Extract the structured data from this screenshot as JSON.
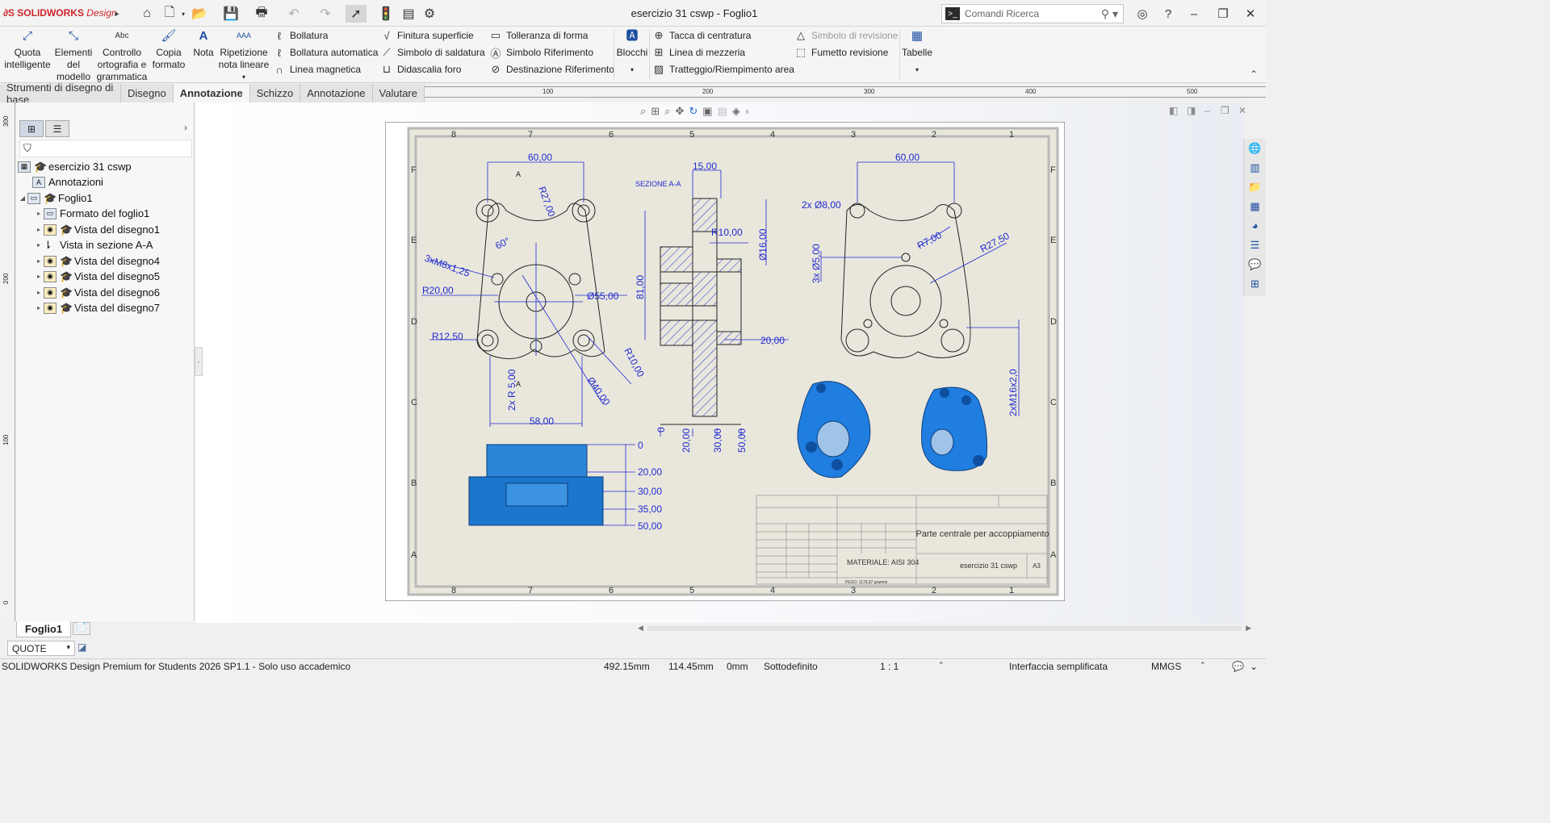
{
  "app": {
    "brand": "SOLIDWORKS",
    "brand_suffix": "Design",
    "window_title": "esercizio 31 cswp - Foglio1",
    "search_placeholder": "Comandi Ricerca"
  },
  "ribbon": {
    "quota": "Quota intelligente",
    "elementi": "Elementi del modello",
    "controllo": "Controllo ortografia e grammatica",
    "copia": "Copia formato",
    "nota": "Nota",
    "ripetizione": "Ripetizione nota lineare",
    "bollatura": "Bollatura",
    "bollatura_auto": "Bollatura automatica",
    "linea_magnetica": "Linea magnetica",
    "finitura": "Finitura superficie",
    "saldatura": "Simbolo di saldatura",
    "didascalia": "Didascalia foro",
    "tolleranza": "Tolleranza di forma",
    "riferimento": "Simbolo Riferimento",
    "destinazione": "Destinazione Riferimento",
    "blocchi": "Blocchi",
    "centratura": "Tacca di centratura",
    "mezzeria": "Linea di mezzeria",
    "tratteggio": "Tratteggio/Riempimento area",
    "simbolo_revisione": "Simbolo di revisione",
    "fumetto": "Fumetto revisione",
    "tabelle": "Tabelle",
    "abc": "Abc"
  },
  "tabs": [
    "Strumenti di disegno di base",
    "Disegno",
    "Annotazione",
    "Schizzo",
    "Annotazione",
    "Valutare"
  ],
  "ruler_h": [
    "100",
    "200",
    "300",
    "400",
    "500"
  ],
  "ruler_v": [
    "300",
    "200",
    "100",
    "0"
  ],
  "tree": {
    "root": "esercizio 31 cswp",
    "annotazioni": "Annotazioni",
    "foglio": "Foglio1",
    "formato": "Formato del foglio1",
    "vista1": "Vista del disegno1",
    "sezione": "Vista in sezione A-A",
    "vista4": "Vista del disegno4",
    "vista5": "Vista del disegno5",
    "vista6": "Vista del disegno6",
    "vista7": "Vista del disegno7"
  },
  "drawing": {
    "zone_cols": [
      "8",
      "7",
      "6",
      "5",
      "4",
      "3",
      "2",
      "1"
    ],
    "zone_rows": [
      "F",
      "E",
      "D",
      "C",
      "B",
      "A"
    ],
    "dims_front": [
      "60,00",
      "R27,00",
      "60°",
      "3xM8x1,25",
      "R20,00",
      "Ø55,00",
      "R12,50",
      "R10,00",
      "Ø40,00",
      "2x R 5,00",
      "58,00",
      "A",
      "A"
    ],
    "section_label": "SEZIONE A-A",
    "dims_section": [
      "15,00",
      "R10,00",
      "Ø16,00",
      "81,00",
      "20,00",
      "0",
      "20,00",
      "30,00",
      "50,00"
    ],
    "dims_back": [
      "60,00",
      "2x Ø8,00",
      "R7,00",
      "R27,50",
      "3x Ø5,00",
      "2xM16x2,0"
    ],
    "dims_bottom": [
      "0",
      "20,00",
      "30,00",
      "35,00",
      "50,00"
    ],
    "title_block": {
      "part_title": "Parte centrale per accoppiamento",
      "material": "MATERIALE: AISI 304",
      "drawing_name": "esercizio 31 cswp",
      "size": "A3",
      "weight": "PESO: 1179,87 grammi"
    }
  },
  "sheet_tab": "Foglio1",
  "quote_select": "QUOTE",
  "status": {
    "product": "SOLIDWORKS Design Premium for Students 2026 SP1.1 - Solo uso accademico",
    "x": "492.15mm",
    "y": "114.45mm",
    "z": "0mm",
    "state": "Sottodefinito",
    "scale": "1 : 1",
    "ui_mode": "Interfaccia semplificata",
    "units": "MMGS"
  }
}
